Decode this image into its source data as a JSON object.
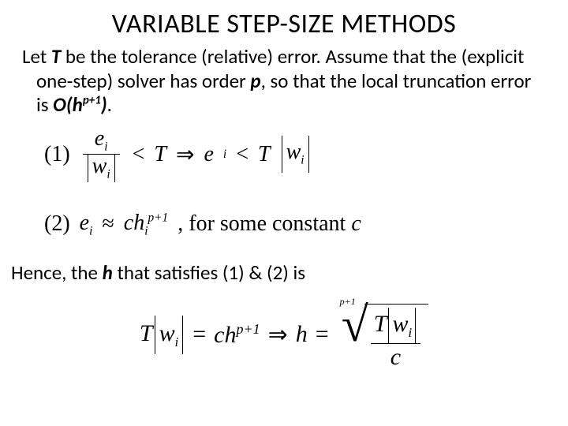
{
  "title": "VARIABLE STEP-SIZE METHODS",
  "intro": {
    "p1a": "Let ",
    "T": "T",
    "p1b": " be the tolerance (relative) error. Assume that the (explicit one-step) solver has order ",
    "p": "p",
    "p1c": ", so that the local truncation error is ",
    "Oh": "O(h",
    "exp": "p+1",
    "close": ")",
    "dot": "."
  },
  "eq1": {
    "num": "(1)",
    "e": "e",
    "i": "i",
    "w": "w",
    "lt": "<",
    "T": "T",
    "imp": "⇒"
  },
  "eq2": {
    "num": "(2)",
    "e": "e",
    "i": "i",
    "approx": "≈",
    "c": "c",
    "h": "h",
    "pp1": "p+1",
    "tail": ", for some constant ",
    "c2": "c"
  },
  "hence": {
    "a": "Hence, the ",
    "h": "h",
    "b": " that satisfies (1) & (2) is"
  },
  "final": {
    "T": "T",
    "w": "w",
    "i": "i",
    "eq": "=",
    "c": "c",
    "h": "h",
    "pp1": "p+1",
    "imp": "⇒",
    "index": "p+1"
  }
}
